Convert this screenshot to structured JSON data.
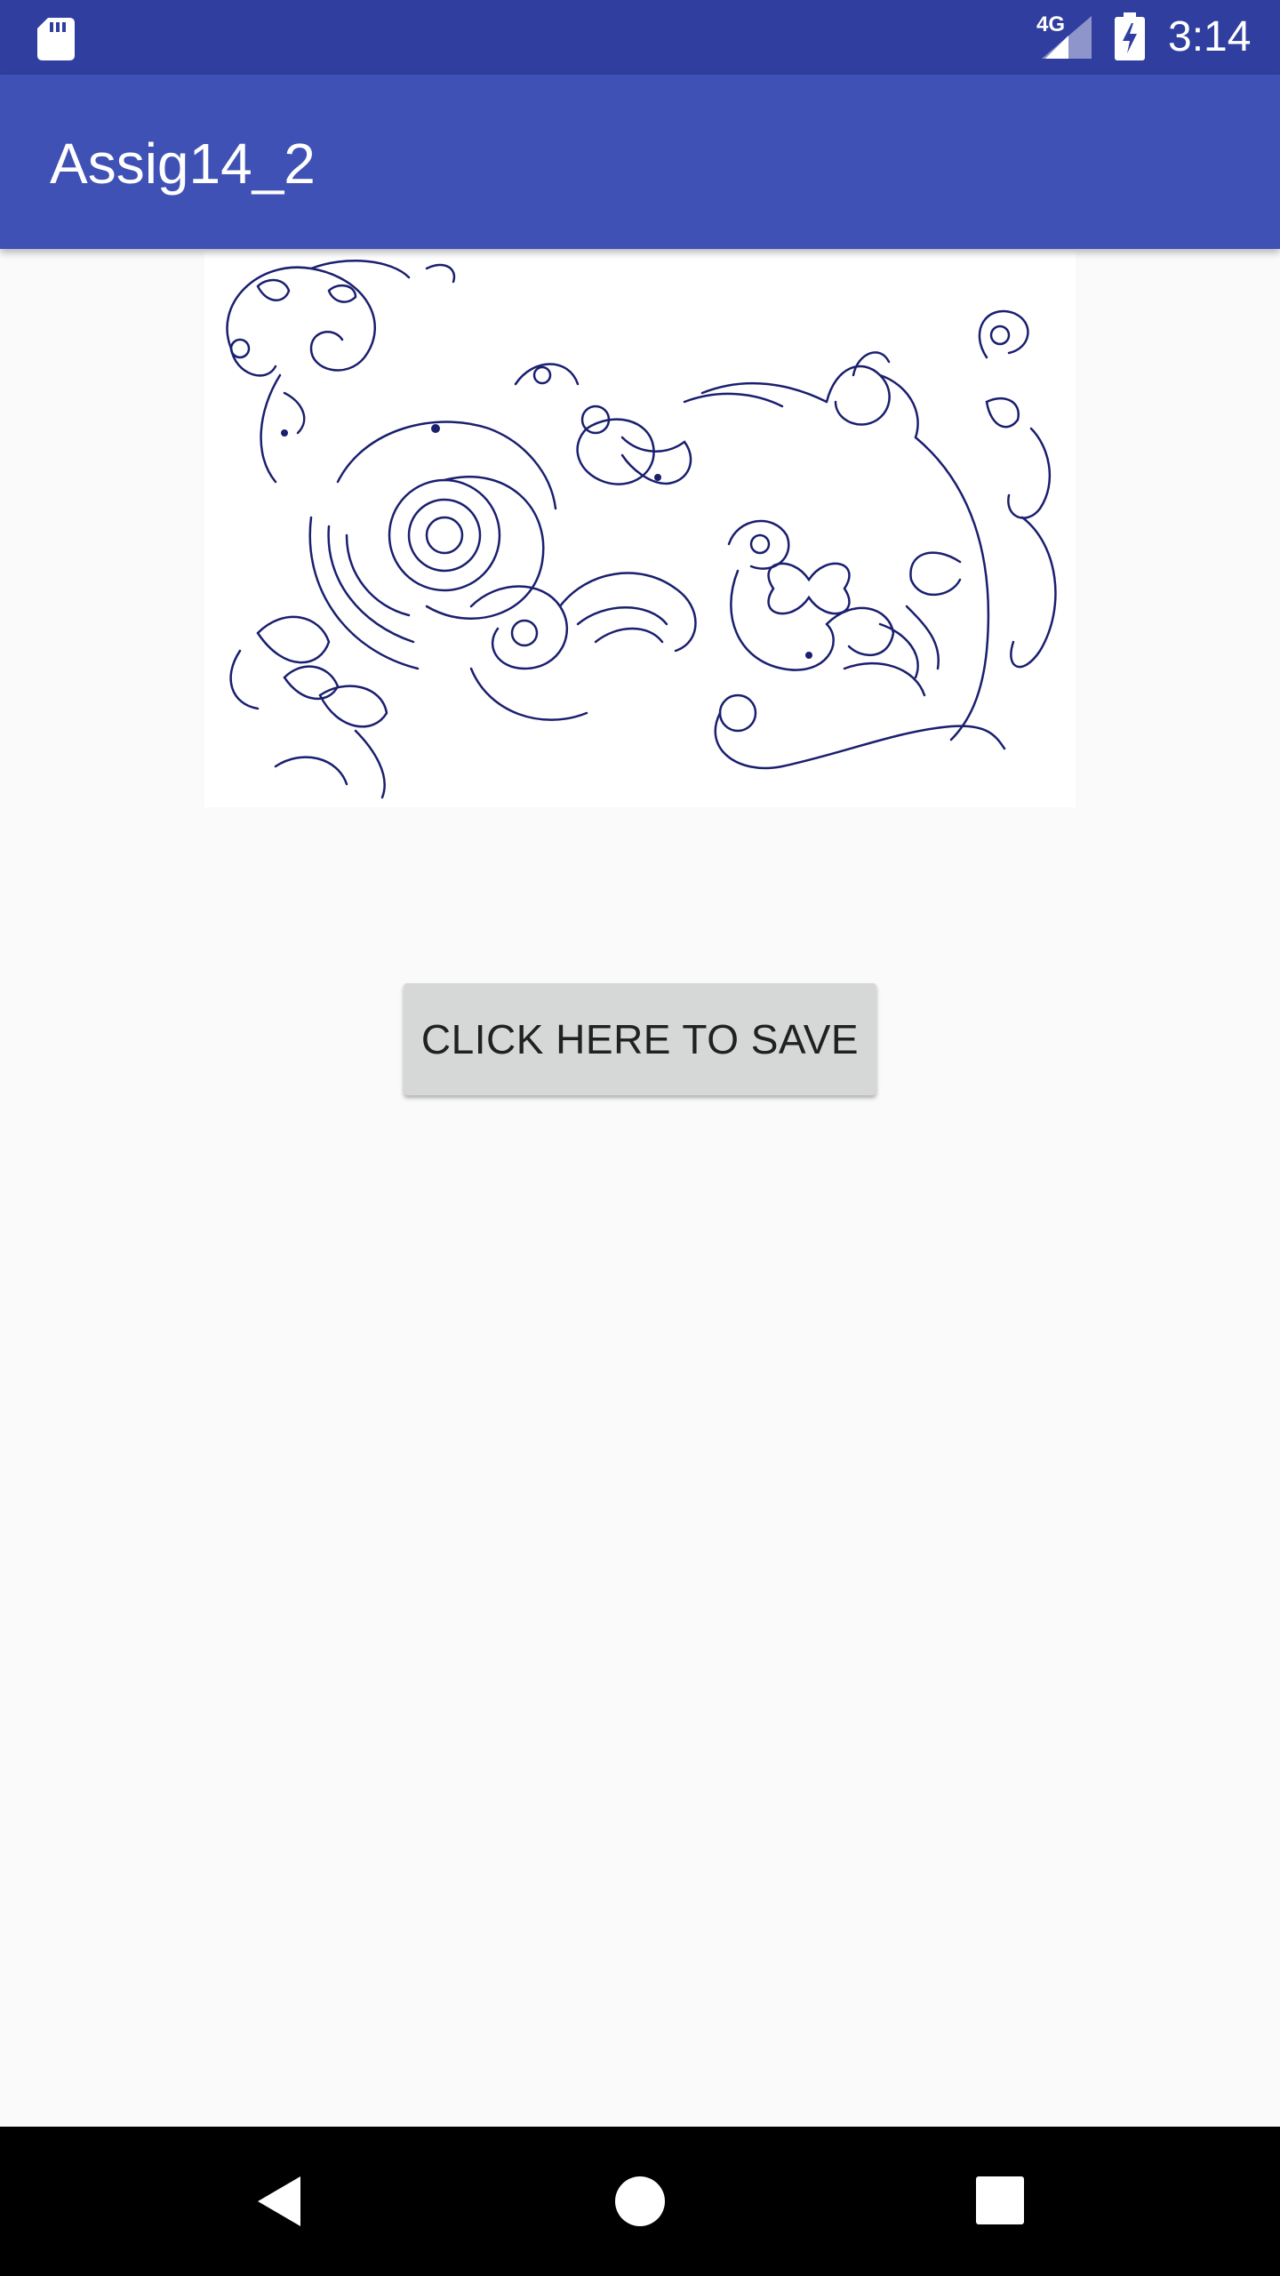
{
  "status_bar": {
    "network_label": "4G",
    "time": "3:14",
    "icons": [
      "sd-card-icon",
      "signal-icon",
      "battery-charging-icon"
    ],
    "background": "#303f9f"
  },
  "app_bar": {
    "title": "Assig14_2",
    "background": "#3f51b5"
  },
  "content": {
    "image_description": "ornamental-floral-line-art",
    "save_button_label": "CLICK HERE TO SAVE",
    "button_color": "#d6d7d7"
  },
  "nav_bar": {
    "icons": [
      "back-icon",
      "home-icon",
      "recents-icon"
    ],
    "background": "#000000"
  },
  "colors": {
    "page_background": "#fafafa",
    "ink": "#1a1f6e"
  }
}
